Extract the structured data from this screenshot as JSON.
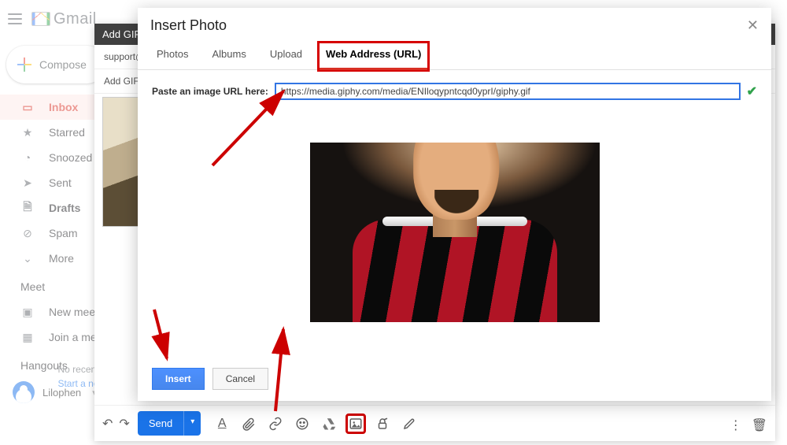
{
  "header": {
    "product": "Gmail"
  },
  "sidebar": {
    "compose": "Compose",
    "items": [
      {
        "icon": "inbox-icon",
        "label": "Inbox",
        "active": true
      },
      {
        "icon": "star-icon",
        "label": "Starred"
      },
      {
        "icon": "snooze-icon",
        "label": "Snoozed"
      },
      {
        "icon": "sent-icon",
        "label": "Sent"
      },
      {
        "icon": "draft-icon",
        "label": "Drafts",
        "bold": true
      },
      {
        "icon": "spam-icon",
        "label": "Spam"
      },
      {
        "icon": "more-icon",
        "label": "More"
      }
    ],
    "meet": {
      "title": "Meet",
      "items": [
        {
          "icon": "newmeeting-icon",
          "label": "New meeting"
        },
        {
          "icon": "joinmeeting-icon",
          "label": "Join a meeting"
        }
      ]
    },
    "hangouts": {
      "title": "Hangouts",
      "user": "Lilophen"
    },
    "footer": {
      "line1": "No recent chats",
      "line2": "Start a new one"
    }
  },
  "compose": {
    "header_title": "Add GIF to Gmail",
    "to_line": "support@",
    "subject_line": "Add GIF to Gmail",
    "send": "Send"
  },
  "modal": {
    "title": "Insert Photo",
    "tabs": [
      "Photos",
      "Albums",
      "Upload",
      "Web Address (URL)"
    ],
    "active_tab_index": 3,
    "url_label": "Paste an image URL here:",
    "url_value": "https://media.giphy.com/media/ENIloqypntcqd0yprI/giphy.gif",
    "insert_label": "Insert",
    "cancel_label": "Cancel"
  }
}
